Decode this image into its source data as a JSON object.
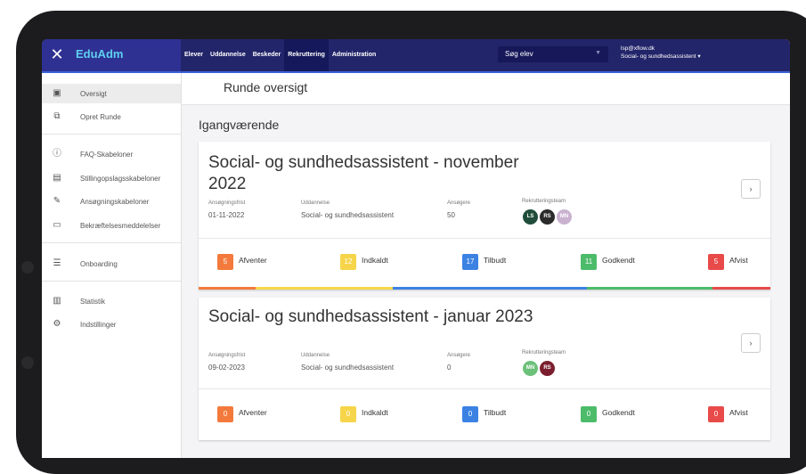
{
  "app": {
    "brand": "EduAdm",
    "close_icon": "close-icon"
  },
  "nav": [
    {
      "label": "Elever"
    },
    {
      "label": "Uddannelse"
    },
    {
      "label": "Beskeder"
    },
    {
      "label": "Rekruttering",
      "active": true
    },
    {
      "label": "Administration"
    }
  ],
  "search": {
    "label": "Søg elev"
  },
  "user": {
    "email": "lsp@xflow.dk",
    "role": "Social- og sundhedsassistent ▾"
  },
  "sidebar": {
    "items": [
      {
        "label": "Oversigt",
        "icon": "overview-icon",
        "active": true
      },
      {
        "label": "Opret Runde",
        "icon": "create-round-icon"
      },
      {
        "label": "FAQ-Skabeloner",
        "icon": "info-icon"
      },
      {
        "label": "Stillingopslagsskabeloner",
        "icon": "document-icon"
      },
      {
        "label": "Ansøgningskabeloner",
        "icon": "pencil-icon"
      },
      {
        "label": "Bekræftelsesmeddelelser",
        "icon": "message-icon"
      },
      {
        "label": "Onboarding",
        "icon": "onboarding-icon"
      },
      {
        "label": "Statistik",
        "icon": "chart-icon"
      },
      {
        "label": "Indstillinger",
        "icon": "settings-icon"
      }
    ]
  },
  "page": {
    "title": "Runde oversigt",
    "section": "Igangværende"
  },
  "meta_labels": {
    "deadline": "Ansøgningsfrist",
    "education": "Uddannelse",
    "applicants": "Ansøgere",
    "team": "Rekrutteringsteam"
  },
  "status_labels": [
    "Afventer",
    "Indkaldt",
    "Tilbudt",
    "Godkendt",
    "Afvist"
  ],
  "status_colors": [
    "#f37a3c",
    "#f6d54a",
    "#3b82e3",
    "#4cbb6a",
    "#e84a4a"
  ],
  "rounds": [
    {
      "title_line1": "Social- og sundhedsassistent - november",
      "title_line2": "2022",
      "deadline": "01-11-2022",
      "education": "Social- og sundhedsassistent",
      "applicants": "50",
      "team": [
        {
          "initials": "LS",
          "color": "#1f4d3a"
        },
        {
          "initials": "RS",
          "color": "#2b2b2b"
        },
        {
          "initials": "MN",
          "color": "#c9b2cf"
        }
      ],
      "counts": [
        "5",
        "12",
        "17",
        "11",
        "5"
      ]
    },
    {
      "title_line1": "Social- og sundhedsassistent - januar 2023",
      "title_line2": "",
      "deadline": "09-02-2023",
      "education": "Social- og sundhedsassistent",
      "applicants": "0",
      "team": [
        {
          "initials": "MN",
          "color": "#6cc17a"
        },
        {
          "initials": "RS",
          "color": "#7a1e2e"
        }
      ],
      "counts": [
        "0",
        "0",
        "0",
        "0",
        "0"
      ]
    }
  ]
}
